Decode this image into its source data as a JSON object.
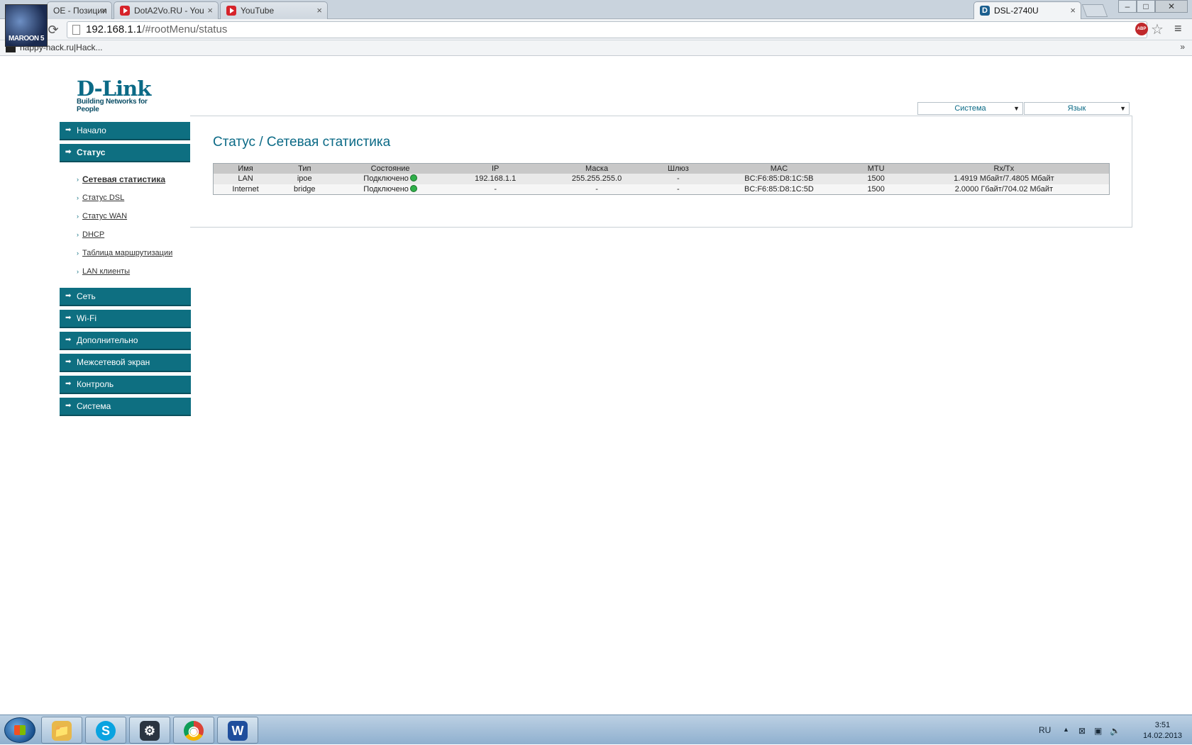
{
  "browser": {
    "tabs": [
      {
        "label": "OE - Позиции",
        "icon": "avatar-icon",
        "active": false
      },
      {
        "label": "DotA2Vo.RU - You",
        "icon": "youtube-icon",
        "active": false
      },
      {
        "label": "YouTube",
        "icon": "youtube-icon",
        "active": false
      },
      {
        "label": "DSL-2740U",
        "icon": "dlink-icon",
        "active": true
      }
    ],
    "tab_close": "×",
    "dlink_favicon_letter": "D",
    "window_buttons": {
      "minimize": "–",
      "maximize": "□",
      "close": "✕"
    },
    "address": {
      "host": "192.168.1.1",
      "path": "/#rootMenu/status"
    },
    "adblock_label": "ABP",
    "avatar_text": "MAROON 5",
    "bookmarks": [
      {
        "label": "happy-hack.ru|Hack..."
      }
    ],
    "bookmarks_overflow": "»"
  },
  "router": {
    "logo": {
      "brand": "D-Link",
      "tagline": "Building Networks for People"
    },
    "top_selects": [
      {
        "label": "Система"
      },
      {
        "label": "Язык"
      }
    ],
    "menu": {
      "home": "Начало",
      "status": "Статус",
      "status_items": [
        "Сетевая статистика",
        "Статус DSL",
        "Статус WAN",
        "DHCP",
        "Таблица маршрутизации",
        "LAN клиенты"
      ],
      "network": "Сеть",
      "wifi": "Wi-Fi",
      "advanced": "Дополнительно",
      "firewall": "Межсетевой экран",
      "control": "Контроль",
      "system": "Система"
    },
    "page_title": "Статус / Сетевая статистика",
    "table": {
      "columns": [
        "Имя",
        "Тип",
        "Состояние",
        "IP",
        "Маска",
        "Шлюз",
        "MAC",
        "MTU",
        "Rx/Tx"
      ],
      "rows": [
        [
          "LAN",
          "ipoe",
          "Подключено",
          "192.168.1.1",
          "255.255.255.0",
          "-",
          "BC:F6:85:D8:1C:5B",
          "1500",
          "1.4919 Мбайт/7.4805 Мбайт"
        ],
        [
          "Internet",
          "bridge",
          "Подключено",
          "-",
          "-",
          "-",
          "BC:F6:85:D8:1C:5D",
          "1500",
          "2.0000 Гбайт/704.02 Мбайт"
        ]
      ],
      "status_color": "#2fb04a"
    }
  },
  "taskbar": {
    "apps": [
      {
        "name": "explorer",
        "glyph": "📁"
      },
      {
        "name": "skype",
        "glyph": "S"
      },
      {
        "name": "steam",
        "glyph": "⚙"
      },
      {
        "name": "chrome",
        "glyph": "◉"
      },
      {
        "name": "word",
        "glyph": "W"
      }
    ],
    "lang": "RU",
    "tray_up_arrow": "▲",
    "tray_network_icon": "⊠",
    "tray_power_icon": "▣",
    "tray_volume_icon": "🔈",
    "time": "3:51",
    "date": "14.02.2013"
  },
  "colors": {
    "accent": "#0e6f81",
    "title": "#0b6a86"
  }
}
